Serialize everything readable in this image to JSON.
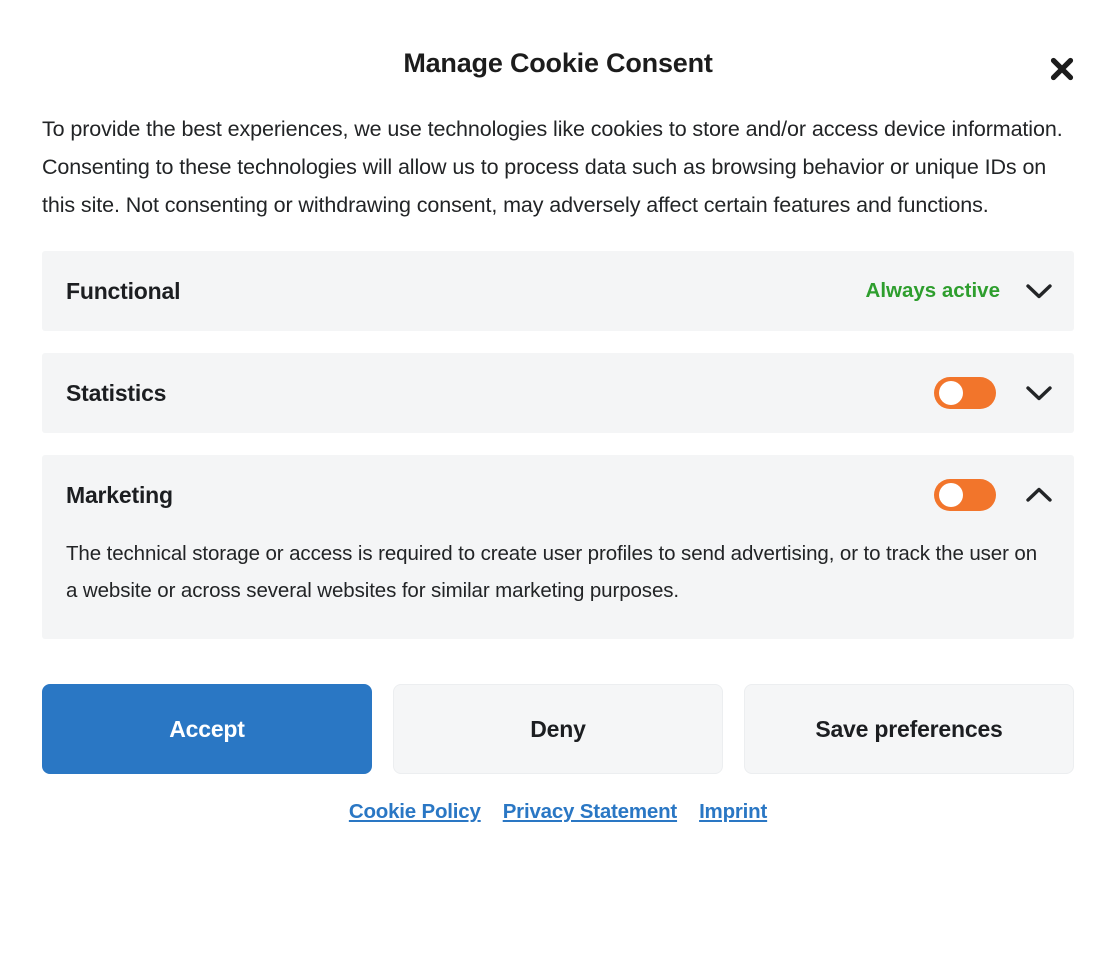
{
  "dialog": {
    "title": "Manage Cookie Consent",
    "close_icon": "close-icon",
    "intro": "To provide the best experiences, we use technologies like cookies to store and/or access device information. Consenting to these technologies will allow us to process data such as browsing behavior or unique IDs on this site. Not consenting or withdrawing consent, may adversely affect certain features and functions."
  },
  "categories": [
    {
      "name": "Functional",
      "status_label": "Always active",
      "has_toggle": false,
      "toggle_on": false,
      "expanded": false,
      "chevron_icon": "chevron-down-icon",
      "description": ""
    },
    {
      "name": "Statistics",
      "status_label": "",
      "has_toggle": true,
      "toggle_on": true,
      "expanded": false,
      "chevron_icon": "chevron-down-icon",
      "description": ""
    },
    {
      "name": "Marketing",
      "status_label": "",
      "has_toggle": true,
      "toggle_on": true,
      "expanded": true,
      "chevron_icon": "chevron-up-icon",
      "description": "The technical storage or access is required to create user profiles to send advertising, or to track the user on a website or across several websites for similar marketing purposes."
    }
  ],
  "actions": {
    "accept_label": "Accept",
    "deny_label": "Deny",
    "save_label": "Save preferences"
  },
  "footer_links": [
    {
      "label": "Cookie Policy"
    },
    {
      "label": "Privacy Statement"
    },
    {
      "label": "Imprint"
    }
  ],
  "colors": {
    "accent_blue": "#2a77c4",
    "toggle_orange": "#f2752b",
    "always_active_green": "#2e9e2e",
    "row_background": "#f4f5f6"
  }
}
